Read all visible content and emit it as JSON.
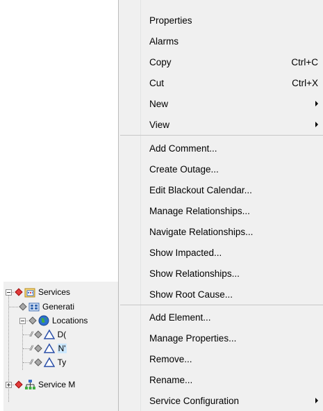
{
  "tree": {
    "services": "Services",
    "general": "Generati",
    "locations": "Locations",
    "loc_d": "D(",
    "loc_n": "N'",
    "loc_t": "Ty",
    "service_m": "Service M"
  },
  "menu": {
    "properties": "Properties",
    "alarms": "Alarms",
    "copy": "Copy",
    "copy_shortcut": "Ctrl+C",
    "cut": "Cut",
    "cut_shortcut": "Ctrl+X",
    "new": "New",
    "view": "View",
    "add_comment": "Add Comment...",
    "create_outage": "Create Outage...",
    "edit_blackout_calendar": "Edit Blackout Calendar...",
    "manage_relationships": "Manage Relationships...",
    "navigate_relationships": "Navigate Relationships...",
    "show_impacted": "Show Impacted...",
    "show_relationships": "Show Relationships...",
    "show_root_cause": "Show Root Cause...",
    "add_element": "Add Element...",
    "manage_properties": "Manage Properties...",
    "remove": "Remove...",
    "rename": "Rename...",
    "service_configuration": "Service Configuration"
  },
  "colors": {
    "menu_bg": "#f0f0f0",
    "separator": "#c8c8c8",
    "selection": "#cce8ff",
    "alarm_red": "#e23b3b",
    "status_gray": "#a8a8a8"
  }
}
